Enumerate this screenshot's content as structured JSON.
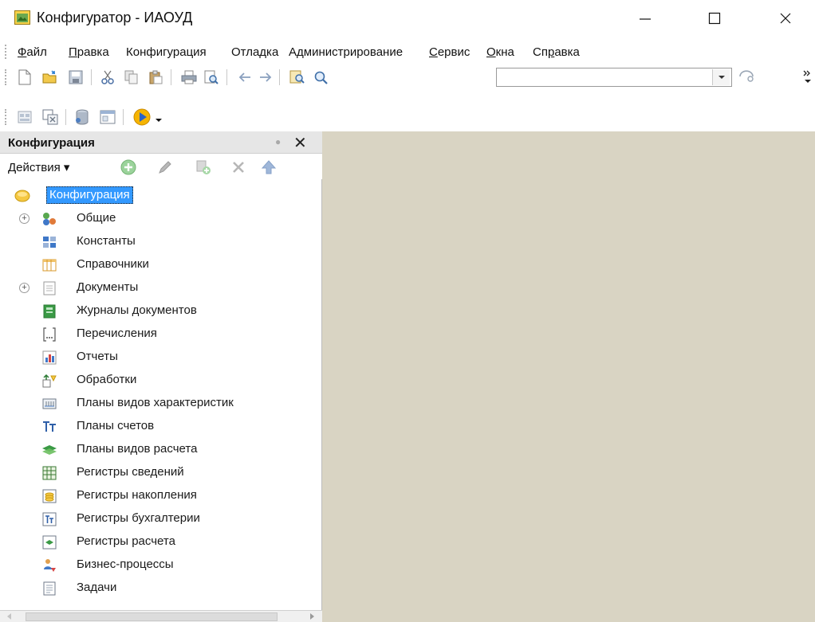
{
  "window": {
    "title": "Конфигуратор - ИАОУД",
    "icon": "app-icon",
    "controls": {
      "minimize": "minimize-icon",
      "maximize": "maximize-icon",
      "close": "close-icon"
    }
  },
  "menu": [
    {
      "label": "Файл",
      "accent": "Ф",
      "rest": "айл"
    },
    {
      "label": "Правка",
      "accent": "П",
      "rest": "равка"
    },
    {
      "label": "Конфигурация"
    },
    {
      "label": "Отладка"
    },
    {
      "label": "Администрирование"
    },
    {
      "label": "Сервис",
      "accent": "С",
      "rest": "ервис"
    },
    {
      "label": "Окна",
      "accent": "О",
      "rest": "кна"
    },
    {
      "label": "Справка",
      "pre": "Сп",
      "accent": "р",
      "rest": "авка"
    }
  ],
  "toolbar1": {
    "icons": [
      "new-document-icon",
      "open-icon",
      "save-icon",
      "cut-icon",
      "copy-icon",
      "paste-icon",
      "print-icon",
      "print-preview-icon",
      "undo-icon",
      "redo-icon",
      "find-in-tree-icon",
      "search-icon",
      "search-next-icon",
      "overflow-icon"
    ],
    "search_value": ""
  },
  "toolbar2": {
    "icons": [
      "open-config-icon",
      "compare-icon",
      "database-icon",
      "window-icon",
      "run-debug-icon",
      "dropdown-icon"
    ]
  },
  "panel": {
    "title": "Конфигурация",
    "actions_label": "Действия",
    "action_icons": [
      "add-icon",
      "edit-icon",
      "copy-item-icon",
      "delete-icon",
      "move-up-icon"
    ]
  },
  "tree": {
    "root": "Конфигурация",
    "items": [
      {
        "label": "Общие",
        "icon": "common-icon",
        "expandable": true
      },
      {
        "label": "Константы",
        "icon": "constants-icon",
        "expandable": false
      },
      {
        "label": "Справочники",
        "icon": "catalogs-icon",
        "expandable": false
      },
      {
        "label": "Документы",
        "icon": "documents-icon",
        "expandable": true
      },
      {
        "label": "Журналы документов",
        "icon": "document-journals-icon",
        "expandable": false
      },
      {
        "label": "Перечисления",
        "icon": "enums-icon",
        "expandable": false
      },
      {
        "label": "Отчеты",
        "icon": "reports-icon",
        "expandable": false
      },
      {
        "label": "Обработки",
        "icon": "data-processors-icon",
        "expandable": false
      },
      {
        "label": "Планы видов характеристик",
        "icon": "characteristic-types-icon",
        "expandable": false
      },
      {
        "label": "Планы счетов",
        "icon": "chart-of-accounts-icon",
        "expandable": false
      },
      {
        "label": "Планы видов расчета",
        "icon": "calculation-types-icon",
        "expandable": false
      },
      {
        "label": "Регистры сведений",
        "icon": "info-registers-icon",
        "expandable": false
      },
      {
        "label": "Регистры накопления",
        "icon": "accumulation-registers-icon",
        "expandable": false
      },
      {
        "label": "Регистры бухгалтерии",
        "icon": "accounting-registers-icon",
        "expandable": false
      },
      {
        "label": "Регистры расчета",
        "icon": "calculation-registers-icon",
        "expandable": false
      },
      {
        "label": "Бизнес-процессы",
        "icon": "business-processes-icon",
        "expandable": false
      },
      {
        "label": "Задачи",
        "icon": "tasks-icon",
        "expandable": false
      }
    ]
  },
  "colors": {
    "workspace": "#d9d4c3",
    "selection": "#3399ff",
    "panel_header": "#e6e6e6"
  }
}
